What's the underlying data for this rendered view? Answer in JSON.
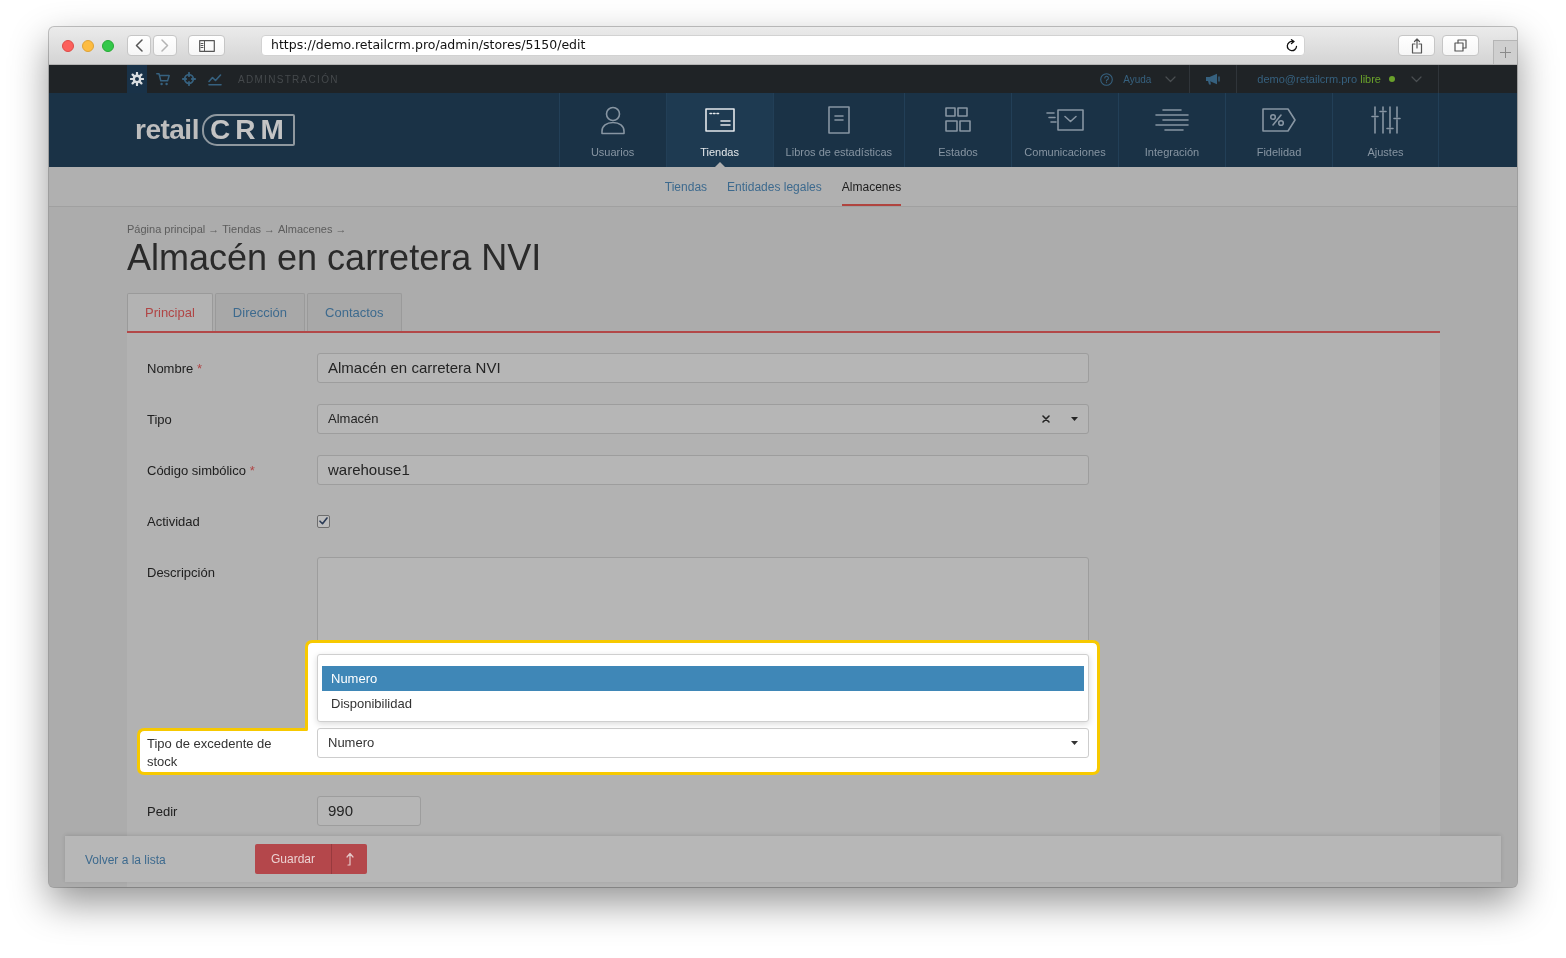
{
  "browser": {
    "nav_buttons": [
      {
        "kind": "back",
        "disabled": false
      },
      {
        "kind": "forward",
        "disabled": true
      }
    ],
    "url": "https://demo.retailcrm.pro/admin/stores/5150/edit"
  },
  "admin_bar": {
    "sections": [
      {
        "kind": "settings",
        "selected": true
      },
      {
        "kind": "cart",
        "selected": false
      },
      {
        "kind": "target",
        "selected": false
      },
      {
        "kind": "analytics",
        "selected": false
      }
    ],
    "title": "ADMINSTRACIÓN",
    "help": "Ayuda",
    "account": {
      "email": "demo@retailcrm.pro",
      "plan": "libre",
      "online": true
    }
  },
  "header": {
    "logo": {
      "text": "retail",
      "accent": "CRM"
    },
    "nav": [
      {
        "kind": "users",
        "label": "Usuarios",
        "selected": false
      },
      {
        "kind": "stores",
        "label": "Tiendas",
        "selected": true
      },
      {
        "kind": "reports",
        "label": "Libros de estadísticas",
        "selected": false
      },
      {
        "kind": "statuses",
        "label": "Estados",
        "selected": false
      },
      {
        "kind": "communications",
        "label": "Comunicaciones",
        "selected": false
      },
      {
        "kind": "integration",
        "label": "Integración",
        "selected": false
      },
      {
        "kind": "loyalty",
        "label": "Fidelidad",
        "selected": false
      },
      {
        "kind": "settings",
        "label": "Ajustes",
        "selected": false
      }
    ]
  },
  "subnav": [
    {
      "label": "Tiendas",
      "selected": false
    },
    {
      "label": "Entidades legales",
      "selected": false
    },
    {
      "label": "Almacenes",
      "selected": true
    }
  ],
  "breadcrumb": [
    {
      "label": "Página principal",
      "separator": "→"
    },
    {
      "label": "Tiendas",
      "separator": "→"
    },
    {
      "label": "Almacenes",
      "separator": "→"
    }
  ],
  "title": "Almacén en carretera NVI",
  "tabs": [
    {
      "label": "Principal",
      "selected": true
    },
    {
      "label": "Dirección",
      "selected": false
    },
    {
      "label": "Contactos",
      "selected": false
    }
  ],
  "form": {
    "fields": [
      {
        "kind": "text",
        "label": "Nombre",
        "required_mark": "*",
        "value": "Almacén en carretera NVI"
      },
      {
        "kind": "select",
        "label": "Tipo",
        "value": "Almacén",
        "clearable": true
      },
      {
        "kind": "text",
        "label": "Código simbólico",
        "required_mark": "*",
        "value": "warehouse1"
      },
      {
        "kind": "checkbox",
        "label": "Actividad",
        "checked": true
      },
      {
        "kind": "textarea",
        "label": "Descripción"
      },
      {
        "kind": "select",
        "label": "Tipo de excedente de stock",
        "value": "Numero",
        "highlighted": true,
        "expanded": true,
        "options": [
          {
            "label": "Numero",
            "selected": true
          },
          {
            "label": "Disponibilidad",
            "selected": false
          }
        ]
      },
      {
        "kind": "short",
        "label": "Pedir",
        "value": "990"
      }
    ]
  },
  "footer": {
    "back_link": "Volver a la lista",
    "save_button": "Guardar"
  }
}
